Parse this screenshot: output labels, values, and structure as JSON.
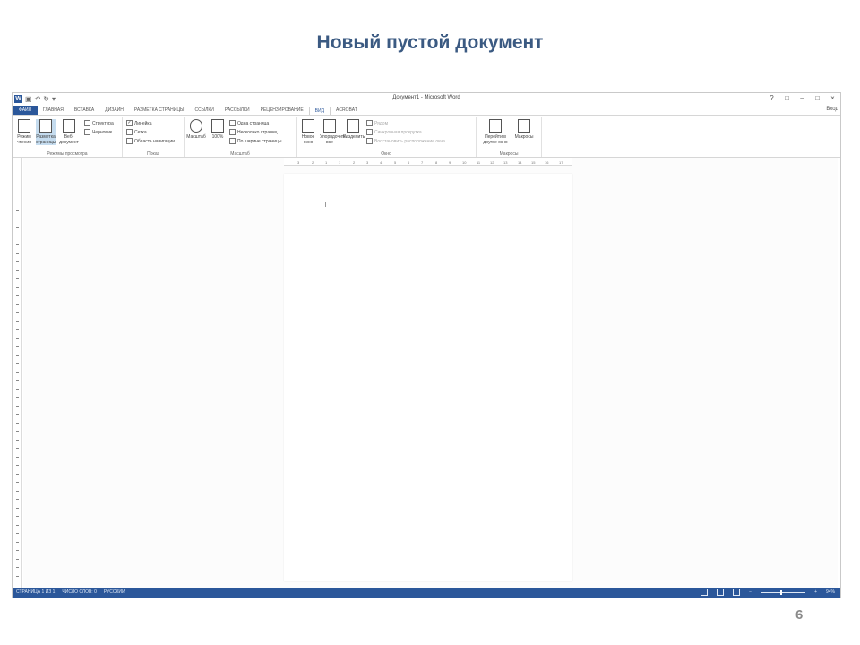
{
  "slide": {
    "title": "Новый пустой документ",
    "page_number": "6"
  },
  "window": {
    "title": "Документ1 - Microsoft Word",
    "signin": "Вход",
    "controls": [
      "?",
      "□",
      "–",
      "□",
      "×"
    ]
  },
  "tabs": [
    "ФАЙЛ",
    "ГЛАВНАЯ",
    "ВСТАВКА",
    "ДИЗАЙН",
    "РАЗМЕТКА СТРАНИЦЫ",
    "ССЫЛКИ",
    "РАССЫЛКИ",
    "РЕЦЕНЗИРОВАНИЕ",
    "ВИД",
    "ACROBAT"
  ],
  "active_tab": "ВИД",
  "ribbon": {
    "views": {
      "label": "Режимы просмотра",
      "read_mode": "Режим чтения",
      "print_layout": "Разметка страницы",
      "web_layout": "Веб-документ",
      "outline": "Структура",
      "draft": "Черновик"
    },
    "show": {
      "label": "Показ",
      "ruler": "Линейка",
      "gridlines": "Сетка",
      "nav_pane": "Область навигации"
    },
    "zoom": {
      "label": "Масштаб",
      "zoom": "Масштаб",
      "hundred": "100%",
      "one_page": "Одна страница",
      "multiple_pages": "Несколько страниц",
      "page_width": "По ширине страницы"
    },
    "window": {
      "label": "Окно",
      "new_window": "Новое окно",
      "arrange_all": "Упорядочить все",
      "split": "Разделить",
      "side_by_side": "Рядом",
      "sync_scroll": "Синхронная прокрутка",
      "reset_position": "Восстановить расположение окна",
      "switch_windows": "Перейти в другое окно"
    },
    "macros": {
      "label": "Макросы",
      "macros": "Макросы"
    }
  },
  "ruler_ticks": [
    "3",
    "2",
    "1",
    "1",
    "2",
    "3",
    "4",
    "5",
    "6",
    "7",
    "8",
    "9",
    "10",
    "11",
    "12",
    "13",
    "14",
    "15",
    "16",
    "17"
  ],
  "status": {
    "page": "СТРАНИЦА 1 ИЗ 1",
    "words": "ЧИСЛО СЛОВ: 0",
    "language": "РУССКИЙ",
    "zoom": "94%"
  },
  "colors": {
    "accent": "#2b579a",
    "title": "#3b5a82"
  }
}
